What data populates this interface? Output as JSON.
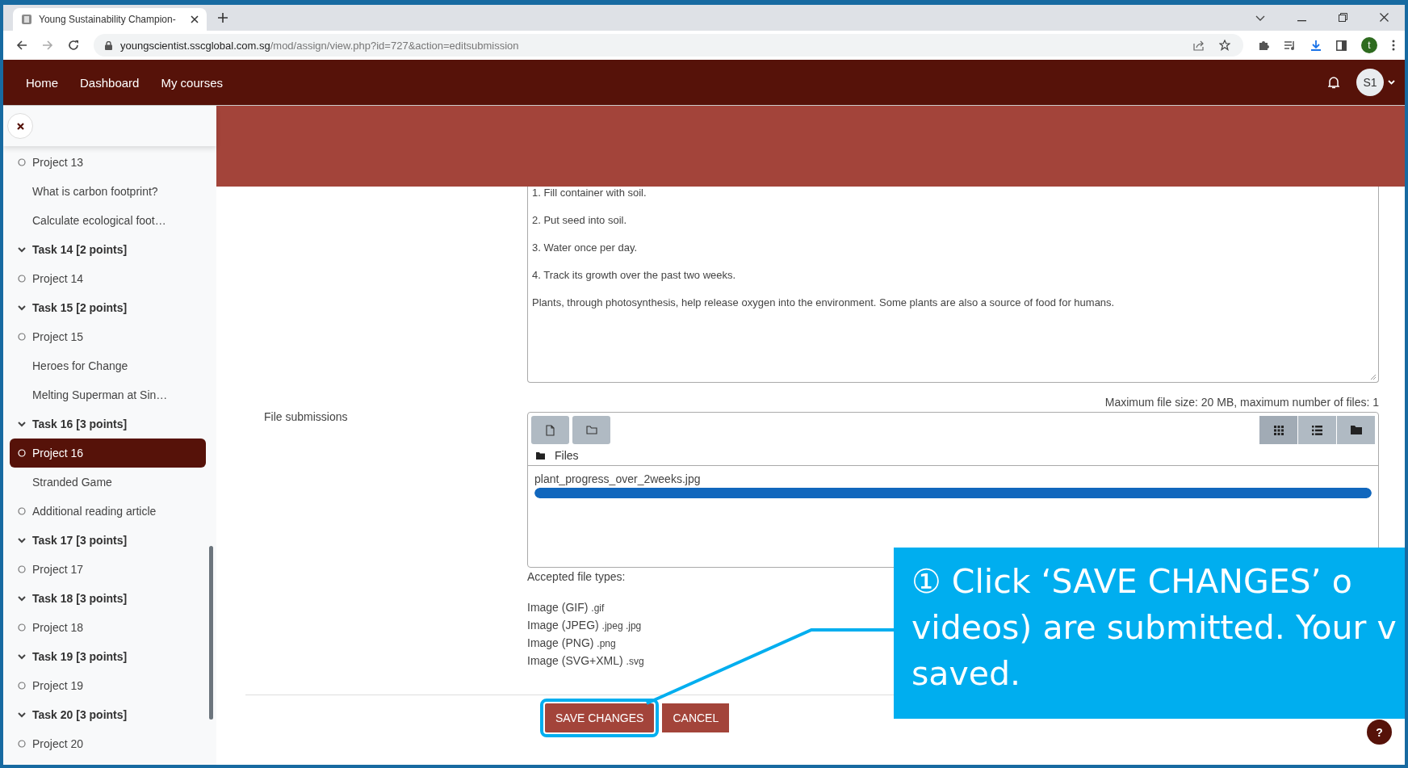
{
  "browser": {
    "tab_title": "Young Sustainability Champion-",
    "url_domain": "youngscientist.sscglobal.com.sg",
    "url_path": "/mod/assign/view.php?id=727&action=editsubmission",
    "profile_initial": "t"
  },
  "navbar": {
    "links": [
      "Home",
      "Dashboard",
      "My courses"
    ],
    "user_initials": "S1"
  },
  "sidebar": {
    "items": [
      {
        "kind": "activity",
        "label": "Project 13",
        "selected": false
      },
      {
        "kind": "resource",
        "label": "What is carbon footprint?",
        "selected": false
      },
      {
        "kind": "resource",
        "label": "Calculate ecological foot…",
        "selected": false
      },
      {
        "kind": "task",
        "label": "Task 14 [2 points]",
        "selected": false
      },
      {
        "kind": "activity",
        "label": "Project 14",
        "selected": false
      },
      {
        "kind": "task",
        "label": "Task 15 [2 points]",
        "selected": false
      },
      {
        "kind": "activity",
        "label": "Project 15",
        "selected": false
      },
      {
        "kind": "resource",
        "label": "Heroes for Change",
        "selected": false
      },
      {
        "kind": "resource",
        "label": "Melting Superman at Sin…",
        "selected": false
      },
      {
        "kind": "task",
        "label": "Task 16 [3 points]",
        "selected": false
      },
      {
        "kind": "activity",
        "label": "Project 16",
        "selected": true
      },
      {
        "kind": "resource",
        "label": "Stranded Game",
        "selected": false
      },
      {
        "kind": "activity",
        "label": "Additional reading article",
        "selected": false
      },
      {
        "kind": "task",
        "label": "Task 17 [3 points]",
        "selected": false
      },
      {
        "kind": "activity",
        "label": "Project 17",
        "selected": false
      },
      {
        "kind": "task",
        "label": "Task 18 [3 points]",
        "selected": false
      },
      {
        "kind": "activity",
        "label": "Project 18",
        "selected": false
      },
      {
        "kind": "task",
        "label": "Task 19 [3 points]",
        "selected": false
      },
      {
        "kind": "activity",
        "label": "Project 19",
        "selected": false
      },
      {
        "kind": "task",
        "label": "Task 20 [3 points]",
        "selected": false
      },
      {
        "kind": "activity",
        "label": "Project 20",
        "selected": false
      }
    ]
  },
  "online_text": [
    "1. Fill container with soil.",
    "2. Put seed into soil.",
    "3. Water once per day.",
    "4. Track its growth over the past two weeks.",
    "Plants, through photosynthesis, help release oxygen into the environment. Some plants are also a source of food for humans."
  ],
  "file_submissions": {
    "label": "File submissions",
    "limits": "Maximum file size: 20 MB, maximum number of files: 1",
    "folder": "Files",
    "files": [
      {
        "name": "plant_progress_over_2weeks.jpg",
        "level": 1.0
      }
    ],
    "accepted_heading": "Accepted file types:",
    "accepted_types": [
      {
        "name": "Image (GIF)",
        "ext": ".gif"
      },
      {
        "name": "Image (JPEG)",
        "ext": ".jpeg .jpg"
      },
      {
        "name": "Image (PNG)",
        "ext": ".png"
      },
      {
        "name": "Image (SVG+XML)",
        "ext": ".svg"
      }
    ]
  },
  "buttons": {
    "save": "SAVE CHANGES",
    "cancel": "CANCEL"
  },
  "help": "?",
  "callout": {
    "lines": [
      "① Click ‘SAVE CHANGES’ o",
      "videos) are submitted. Your v",
      "saved."
    ]
  }
}
